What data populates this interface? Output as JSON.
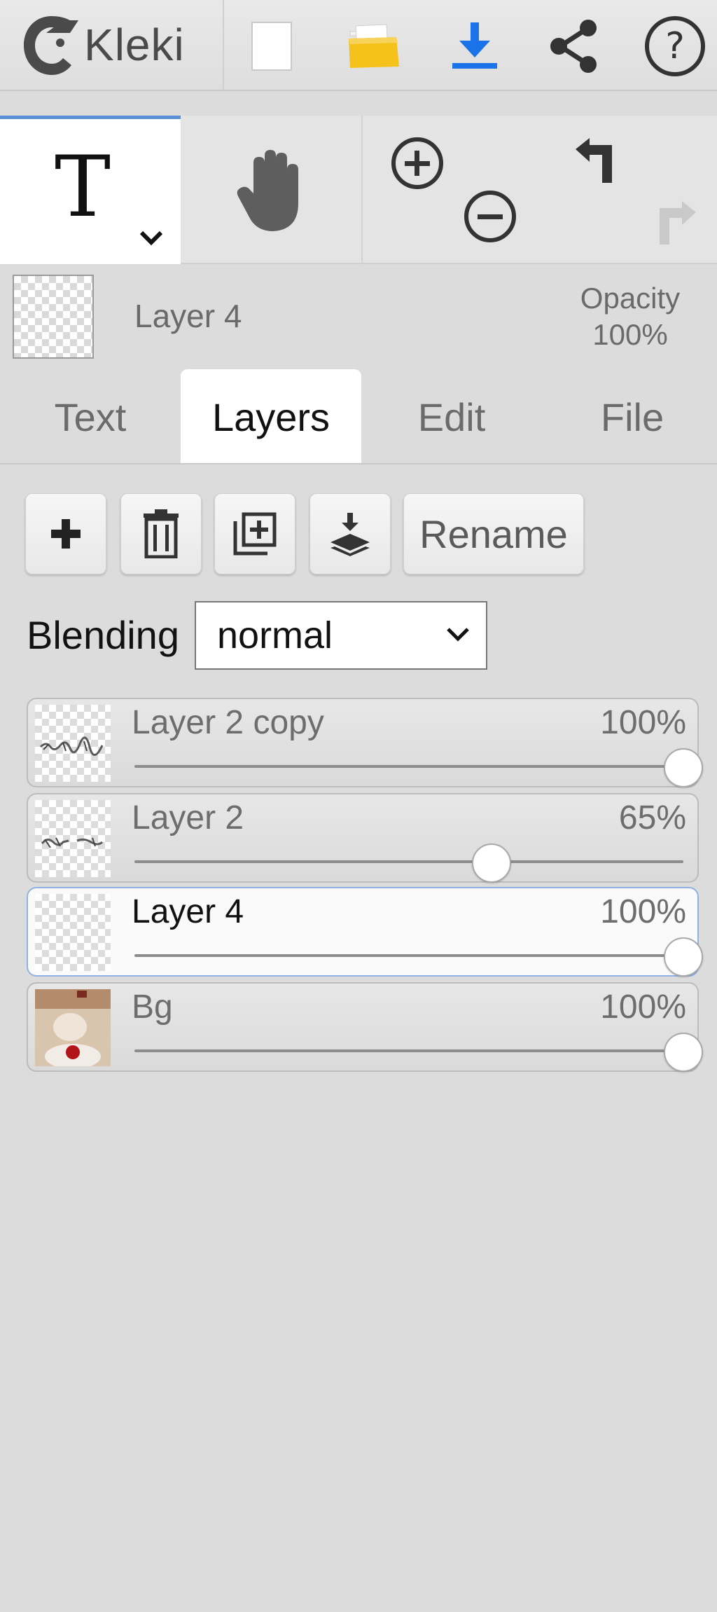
{
  "app": {
    "name": "Kleki"
  },
  "topbar": {
    "buttons": [
      {
        "icon": "new-page-icon"
      },
      {
        "icon": "open-folder-icon"
      },
      {
        "icon": "download-icon",
        "color": "#1a73e8"
      },
      {
        "icon": "share-icon"
      },
      {
        "icon": "help-icon"
      }
    ]
  },
  "tools": {
    "active_tool_glyph": "T",
    "items": [
      {
        "icon": "text-tool-icon"
      },
      {
        "icon": "hand-tool-icon"
      },
      {
        "icon": "zoom-in-icon"
      },
      {
        "icon": "zoom-out-icon"
      },
      {
        "icon": "undo-icon"
      },
      {
        "icon": "redo-icon"
      }
    ]
  },
  "current_layer": {
    "name": "Layer 4",
    "opacity_label": "Opacity",
    "opacity_value": "100%"
  },
  "tabs": [
    {
      "label": "Text",
      "active": false
    },
    {
      "label": "Layers",
      "active": true
    },
    {
      "label": "Edit",
      "active": false
    },
    {
      "label": "File",
      "active": false
    }
  ],
  "layer_actions": {
    "rename_label": "Rename",
    "icons": [
      "add-layer-icon",
      "delete-layer-icon",
      "duplicate-layer-icon",
      "merge-down-icon"
    ]
  },
  "blending": {
    "label": "Blending",
    "value": "normal"
  },
  "layers": [
    {
      "name": "Layer 2 copy",
      "opacity_text": "100%",
      "opacity": 1.0,
      "selected": false
    },
    {
      "name": "Layer 2",
      "opacity_text": "65%",
      "opacity": 0.65,
      "selected": false
    },
    {
      "name": "Layer 4",
      "opacity_text": "100%",
      "opacity": 1.0,
      "selected": true
    },
    {
      "name": "Bg",
      "opacity_text": "100%",
      "opacity": 1.0,
      "selected": false
    }
  ],
  "colors": {
    "accent": "#5b8fd6",
    "download": "#1a73e8",
    "folder": "#f4c21b"
  }
}
